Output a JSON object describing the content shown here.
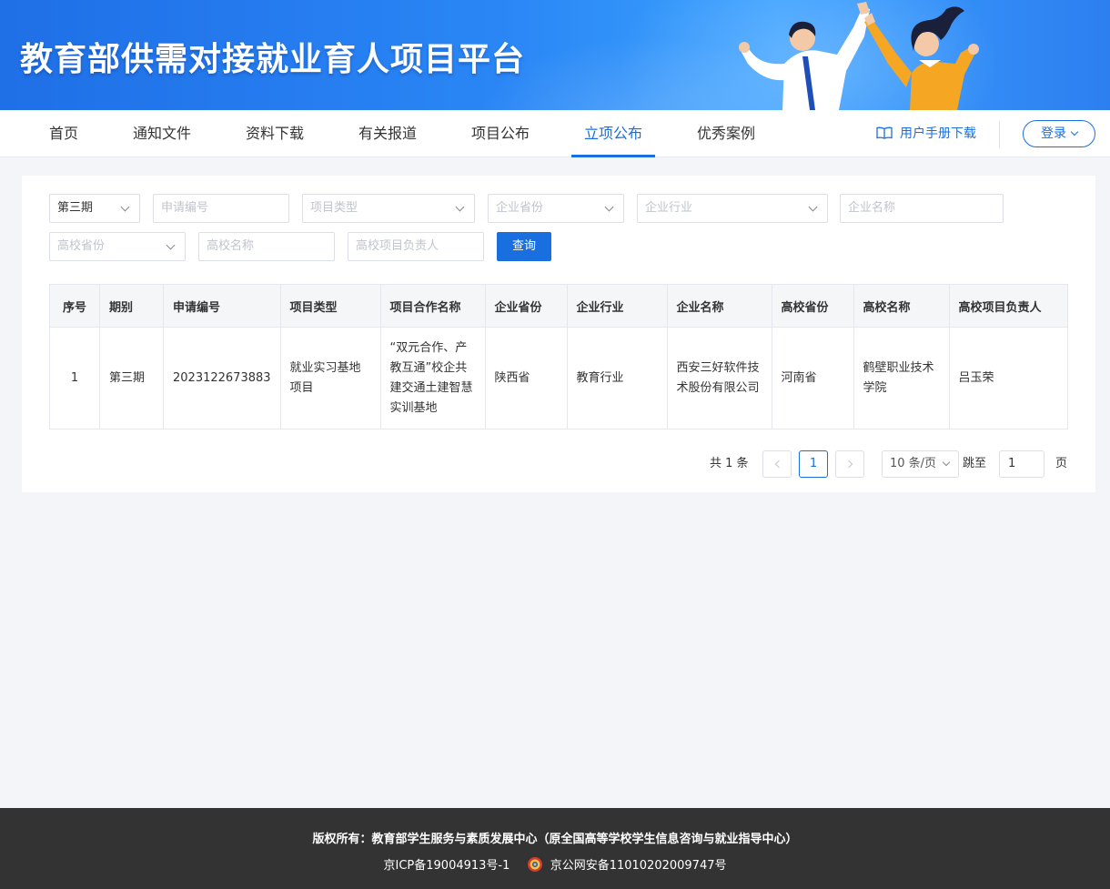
{
  "header": {
    "title": "教育部供需对接就业育人项目平台"
  },
  "nav": {
    "items": [
      {
        "label": "首页"
      },
      {
        "label": "通知文件"
      },
      {
        "label": "资料下载"
      },
      {
        "label": "有关报道"
      },
      {
        "label": "项目公布"
      },
      {
        "label": "立项公布"
      },
      {
        "label": "优秀案例"
      }
    ],
    "active_index": 5,
    "manual_label": "用户手册下载",
    "login_label": "登录"
  },
  "filters": {
    "period_value": "第三期",
    "application_no_placeholder": "申请编号",
    "project_type_placeholder": "项目类型",
    "company_province_placeholder": "企业省份",
    "company_industry_placeholder": "企业行业",
    "company_name_placeholder": "企业名称",
    "school_province_placeholder": "高校省份",
    "school_name_placeholder": "高校名称",
    "school_lead_placeholder": "高校项目负责人",
    "query_label": "查询"
  },
  "table": {
    "columns": [
      "序号",
      "期别",
      "申请编号",
      "项目类型",
      "项目合作名称",
      "企业省份",
      "企业行业",
      "企业名称",
      "高校省份",
      "高校名称",
      "高校项目负责人"
    ],
    "rows": [
      [
        "1",
        "第三期",
        "2023122673883",
        "就业实习基地项目",
        "“双元合作、产教互通”校企共建交通土建智慧实训基地",
        "陕西省",
        "教育行业",
        "西安三好软件技术股份有限公司",
        "河南省",
        "鹤壁职业技术学院",
        "吕玉荣"
      ]
    ]
  },
  "pagination": {
    "total_label": "共 1 条",
    "current_page": "1",
    "page_size_label": "10 条/页",
    "jump_label": "跳至",
    "jump_value": "1",
    "page_suffix": "页"
  },
  "footer": {
    "copyright": "版权所有：教育部学生服务与素质发展中心（原全国高等学校学生信息咨询与就业指导中心）",
    "icp": "京ICP备19004913号-1",
    "police": "京公网安备11010202009747号"
  },
  "colors": {
    "accent": "#1a6fe0",
    "footer_bg": "#333333",
    "page_bg": "#f4f5f9"
  }
}
